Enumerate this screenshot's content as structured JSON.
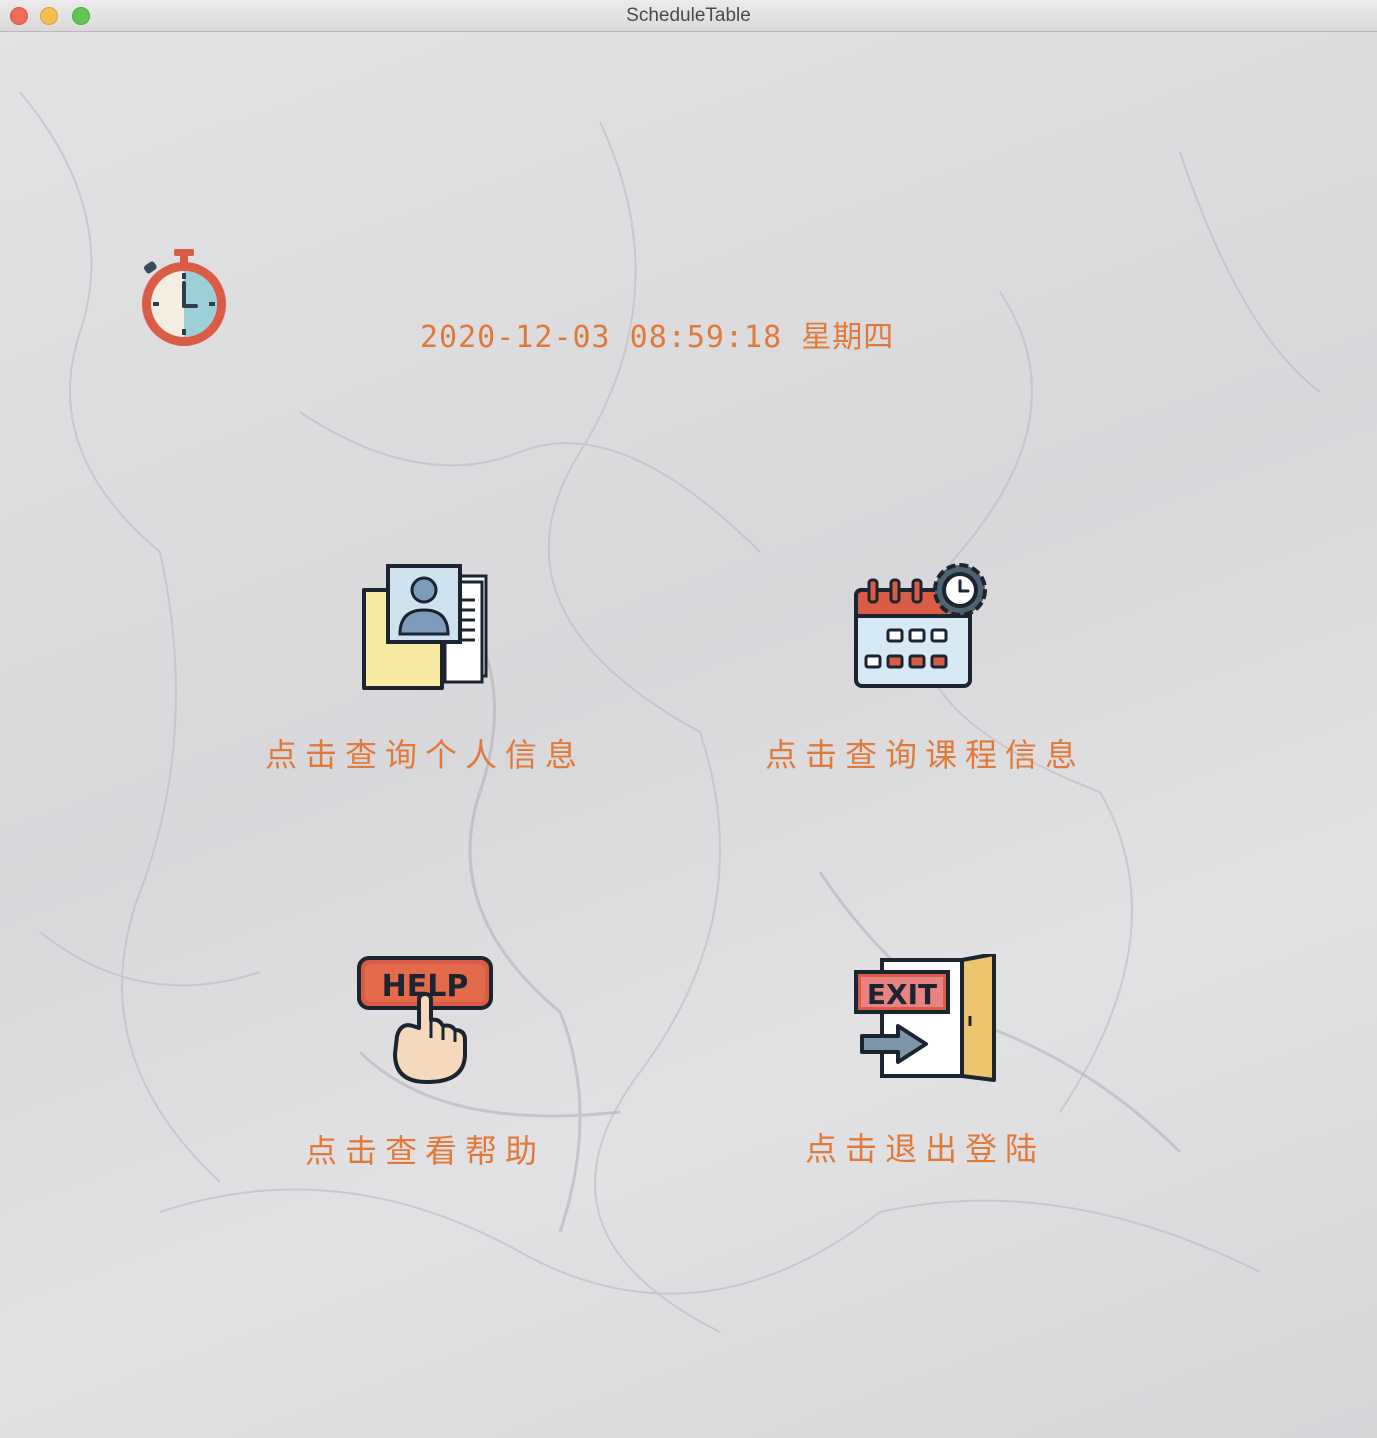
{
  "window": {
    "title": "ScheduleTable"
  },
  "header": {
    "datetime": "2020-12-03 08:59:18 星期四",
    "clock_icon": "stopwatch-icon"
  },
  "menu": [
    {
      "id": "person",
      "label": "点击查询个人信息",
      "icon": "profile-document-icon"
    },
    {
      "id": "course",
      "label": "点击查询课程信息",
      "icon": "calendar-settings-icon"
    },
    {
      "id": "help",
      "label": "点击查看帮助",
      "icon": "help-button-icon",
      "icon_text": "HELP"
    },
    {
      "id": "exit",
      "label": "点击退出登陆",
      "icon": "exit-door-icon",
      "icon_text": "EXIT"
    }
  ],
  "colors": {
    "accent": "#e07a3a",
    "background": "#e0e0e2"
  }
}
